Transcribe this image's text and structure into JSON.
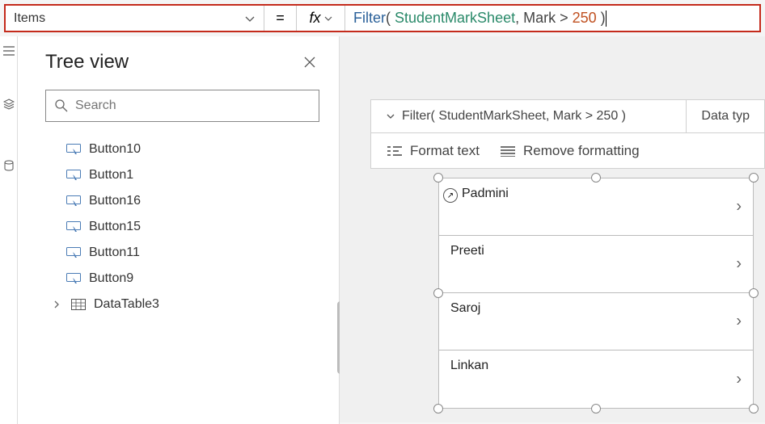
{
  "formula_bar": {
    "property": "Items",
    "eq": "=",
    "fx": "fx",
    "tokens": {
      "func": "Filter",
      "open": "( ",
      "ds": "StudentMarkSheet",
      "sep": ", Mark > ",
      "num": "250",
      "close": " )"
    }
  },
  "tree": {
    "title": "Tree view",
    "search_placeholder": "Search",
    "items": [
      {
        "label": "Button10",
        "type": "button"
      },
      {
        "label": "Button1",
        "type": "button"
      },
      {
        "label": "Button16",
        "type": "button"
      },
      {
        "label": "Button15",
        "type": "button"
      },
      {
        "label": "Button11",
        "type": "button"
      },
      {
        "label": "Button9",
        "type": "button"
      },
      {
        "label": "DataTable3",
        "type": "table",
        "expandable": true
      }
    ]
  },
  "result_bar": {
    "formula_text": "Filter( StudentMarkSheet, Mark > 250 )",
    "data_type": "Data typ"
  },
  "tool_bar": {
    "format": "Format text",
    "remove": "Remove formatting"
  },
  "gallery": {
    "rows": [
      {
        "name": "Padmini",
        "first": true
      },
      {
        "name": "Preeti"
      },
      {
        "name": "Saroj"
      },
      {
        "name": "Linkan"
      }
    ]
  }
}
